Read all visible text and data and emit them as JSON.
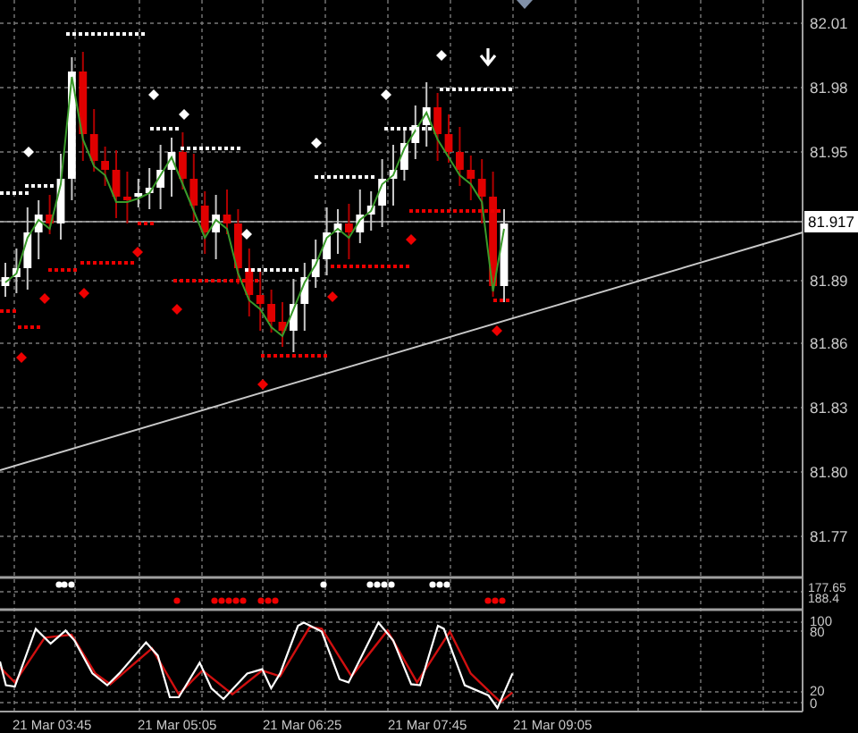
{
  "price_axis": {
    "labels": [
      "82.01",
      "81.98",
      "81.95",
      "81.89",
      "81.86",
      "81.83",
      "81.80",
      "81.77"
    ],
    "current_price": "81.917"
  },
  "indicator_axis": {
    "labels": [
      "177.65",
      "188.4"
    ]
  },
  "oscillator_axis": {
    "labels": [
      "100",
      "80",
      "20",
      "0"
    ]
  },
  "time_axis": {
    "labels": [
      "21 Mar 03:45",
      "21 Mar 05:05",
      "21 Mar 06:25",
      "21 Mar 07:45",
      "21 Mar 09:05"
    ]
  }
}
